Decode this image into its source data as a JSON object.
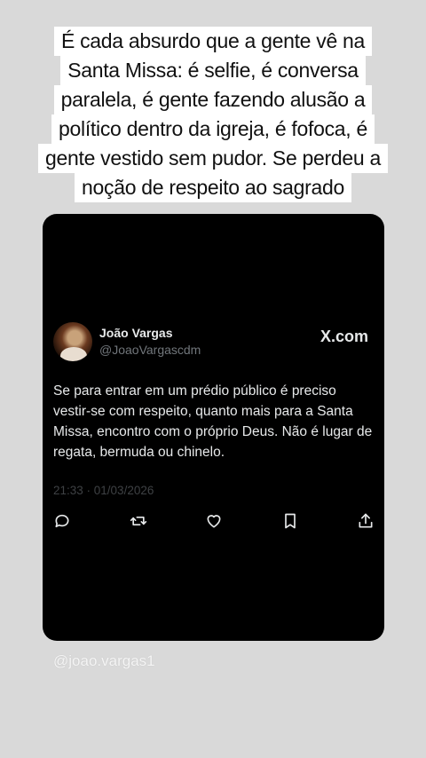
{
  "caption": {
    "lines": [
      "É cada absurdo que a gente vê na",
      "Santa Missa: é selfie, é conversa",
      "paralela, é gente fazendo alusão a",
      "político dentro da igreja, é fofoca, é",
      "gente vestido sem pudor. Se perdeu a",
      "noção de respeito ao sagrado"
    ]
  },
  "tweet": {
    "author_name": "João Vargas",
    "author_handle": "@JoaoVargascdm",
    "source_logo": "X.com",
    "text": "Se para entrar em um prédio público é preciso vestir-se com respeito, quanto mais para a Santa Missa, encontro com o próprio Deus. Não é lugar de regata, bermuda ou chinelo.",
    "timestamp": "21:33 · 01/03/2026",
    "actions": [
      "reply-icon",
      "retweet-icon",
      "like-icon",
      "bookmark-icon",
      "share-icon"
    ]
  },
  "mention": "@joao.vargas1",
  "colors": {
    "background": "#d9d9d9",
    "card": "#000000",
    "text_primary": "#e7e9ea",
    "text_secondary": "#71767b"
  }
}
